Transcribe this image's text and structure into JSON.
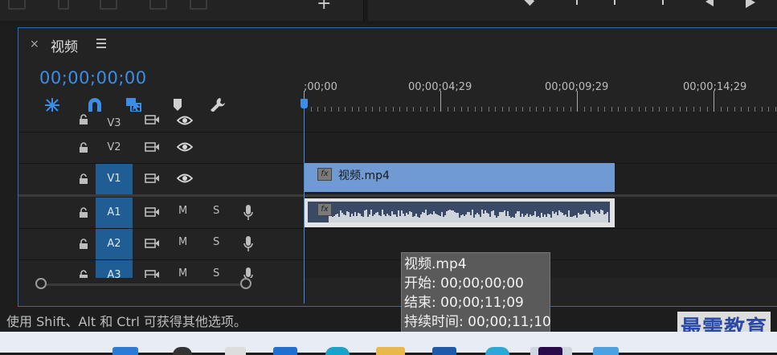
{
  "panel": {
    "close_label": "×",
    "title": "视频",
    "menu_icon": "hamburger-menu-icon",
    "timecode": "00;00;00;00"
  },
  "toolbar_icons": [
    "insert-nest-icon",
    "snap-magnet-icon",
    "linked-selection-icon",
    "add-marker-icon",
    "wrench-settings-icon"
  ],
  "ruler": {
    "labels": [
      ";00;00",
      "00;00;04;29",
      "00;00;09;29",
      "00;00;14;29"
    ]
  },
  "tracks": {
    "video": [
      {
        "name": "V3",
        "active": false
      },
      {
        "name": "V2",
        "active": false
      },
      {
        "name": "V1",
        "active": true
      }
    ],
    "audio": [
      {
        "name": "A1",
        "active": true,
        "mute": "M",
        "solo": "S"
      },
      {
        "name": "A2",
        "active": true,
        "mute": "M",
        "solo": "S"
      },
      {
        "name": "A3",
        "active": true,
        "mute": "M",
        "solo": "S"
      }
    ]
  },
  "clips": {
    "video_clip": {
      "name": "视频.mp4",
      "fx": "fx",
      "color": "#6f9ad3"
    },
    "audio_clip": {
      "fx": "fx",
      "color": "#e3e3e3"
    }
  },
  "status_bar": {
    "text": "使用 Shift、Alt 和 Ctrl 可获得其他选项。"
  },
  "tooltip": {
    "name": "视频.mp4",
    "start": "开始: 00;00;00;00",
    "end": "结束: 00;00;11;09",
    "duration": "持续时间: 00;00;11;10"
  },
  "watermark": "最需教育",
  "colors": {
    "accent": "#3b8ee8",
    "panel_border": "#2d6fb3",
    "active_track": "#1f5d94",
    "work_area": "#f0e226"
  }
}
